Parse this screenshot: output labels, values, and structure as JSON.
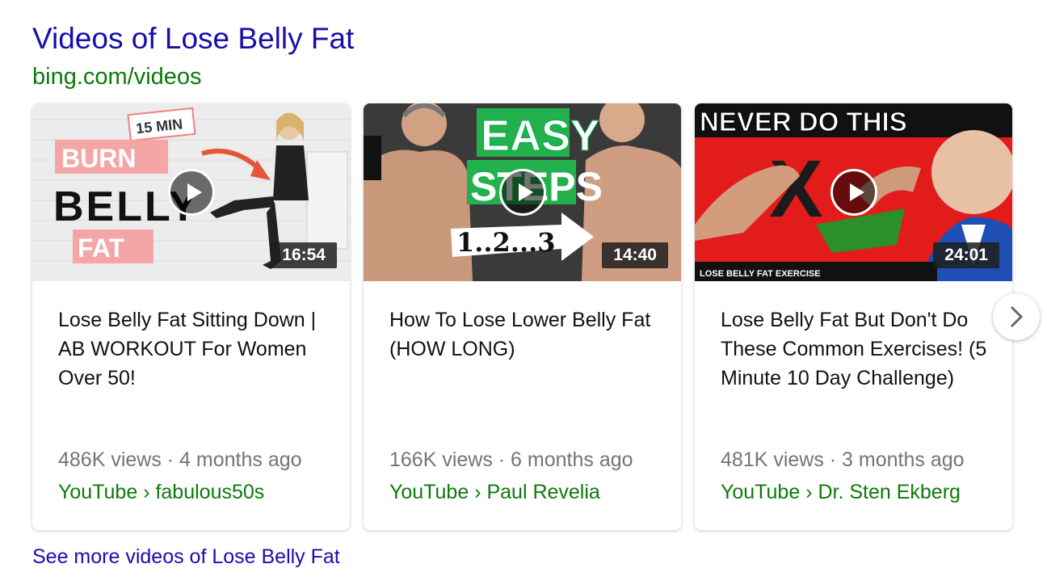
{
  "header": {
    "title": "Videos of Lose Belly Fat",
    "source": "bing.com/videos"
  },
  "videos": [
    {
      "title": "Lose Belly Fat Sitting Down | AB WORKOUT For Women Over 50!",
      "duration": "16:54",
      "meta": "486K views · 4 months ago",
      "channel": "YouTube › fabulous50s",
      "thumb_text": [
        "15 MIN",
        "BURN",
        "BELLY",
        "FAT"
      ]
    },
    {
      "title": "How To Lose Lower Belly Fat (HOW LONG)",
      "duration": "14:40",
      "meta": "166K views · 6 months ago",
      "channel": "YouTube › Paul Revelia",
      "thumb_text": [
        "EASY",
        "STEPS",
        "1..2...3"
      ]
    },
    {
      "title": "Lose Belly Fat But Don't Do These Common Exercises! (5 Minute 10 Day Challenge)",
      "duration": "24:01",
      "meta": "481K views · 3 months ago",
      "channel": "YouTube › Dr. Sten Ekberg",
      "thumb_text": [
        "NEVER DO THIS",
        "X",
        "LOSE BELLY FAT EXERCISE"
      ]
    }
  ],
  "footer": {
    "see_more": "See more videos of Lose Belly Fat"
  },
  "icons": {
    "play": "play-icon",
    "next": "chevron-right-icon"
  },
  "colors": {
    "link": "#1a0dab",
    "url": "#0b7a0b",
    "meta": "#70757a"
  }
}
